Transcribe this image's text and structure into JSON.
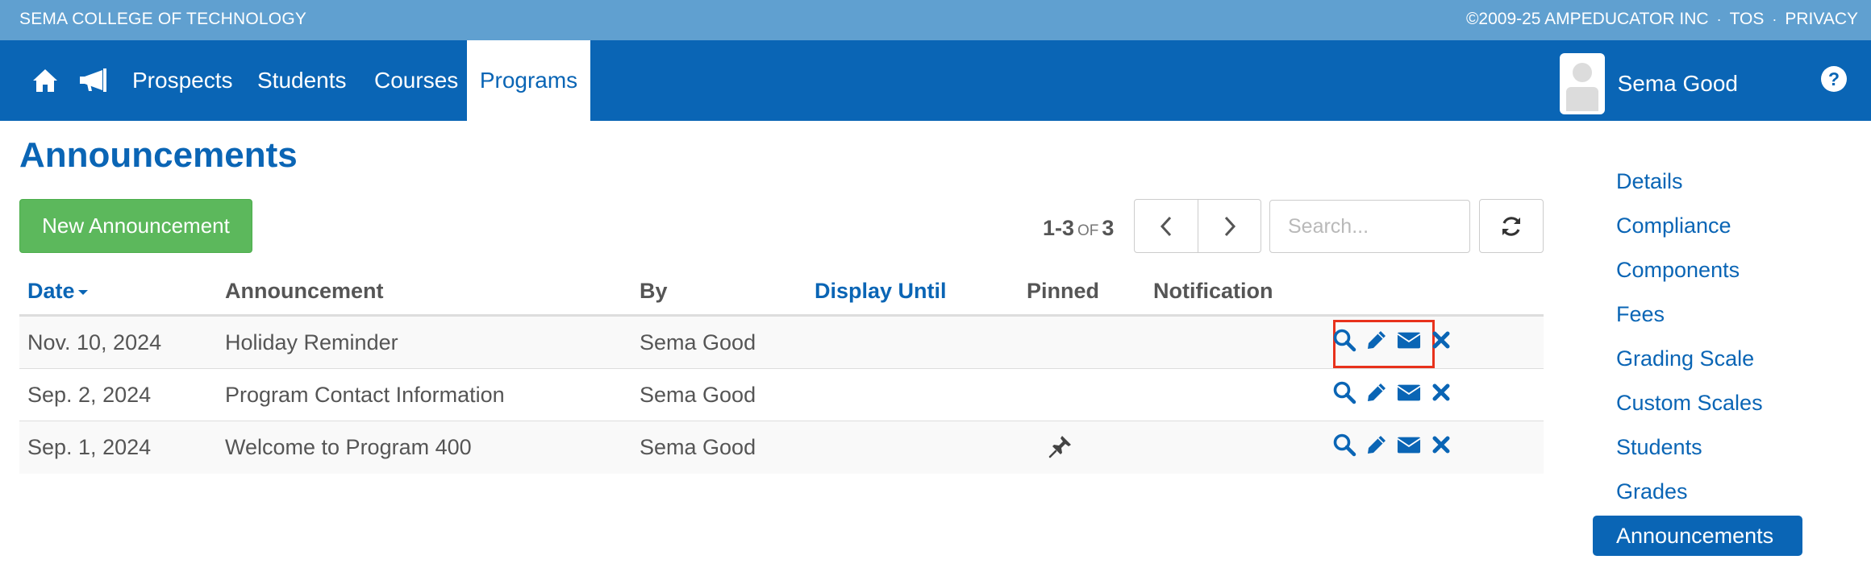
{
  "topbar": {
    "school": "SEMA COLLEGE OF TECHNOLOGY",
    "copyright": "©2009-25 AMPEDUCATOR INC",
    "separator": "·",
    "tos": "TOS",
    "privacy": "PRIVACY"
  },
  "nav": {
    "home_icon": "home-icon",
    "announce_icon": "megaphone-icon",
    "links": [
      "Prospects",
      "Students",
      "Courses",
      "Programs"
    ],
    "active": "Programs",
    "user_name": "Sema Good",
    "help_label": "?"
  },
  "page": {
    "title": "Announcements",
    "new_button": "New Announcement",
    "count_range": "1-3",
    "count_of": "OF",
    "count_total": "3",
    "search_placeholder": "Search..."
  },
  "table": {
    "columns": {
      "date": "Date",
      "announcement": "Announcement",
      "by": "By",
      "display_until": "Display Until",
      "pinned": "Pinned",
      "notification": "Notification"
    },
    "rows": [
      {
        "date": "Nov. 10, 2024",
        "announcement": "Holiday Reminder",
        "by": "Sema Good",
        "display_until": "",
        "pinned": false,
        "notification": ""
      },
      {
        "date": "Sep. 2, 2024",
        "announcement": "Program Contact Information",
        "by": "Sema Good",
        "display_until": "",
        "pinned": false,
        "notification": ""
      },
      {
        "date": "Sep. 1, 2024",
        "announcement": "Welcome to Program 400",
        "by": "Sema Good",
        "display_until": "",
        "pinned": true,
        "notification": ""
      }
    ],
    "row_actions": [
      "search-icon",
      "pencil-icon",
      "envelope-icon",
      "close-icon"
    ]
  },
  "sidebar": {
    "items": [
      "Details",
      "Compliance",
      "Components",
      "Fees",
      "Grading Scale",
      "Custom Scales",
      "Students",
      "Grades",
      "Announcements"
    ],
    "active": "Announcements"
  },
  "colors": {
    "topbar": "#60a0d0",
    "nav": "#0a65b5",
    "accent": "#0a65b5",
    "new_button": "#5cb85c",
    "highlight": "#e8321c"
  }
}
